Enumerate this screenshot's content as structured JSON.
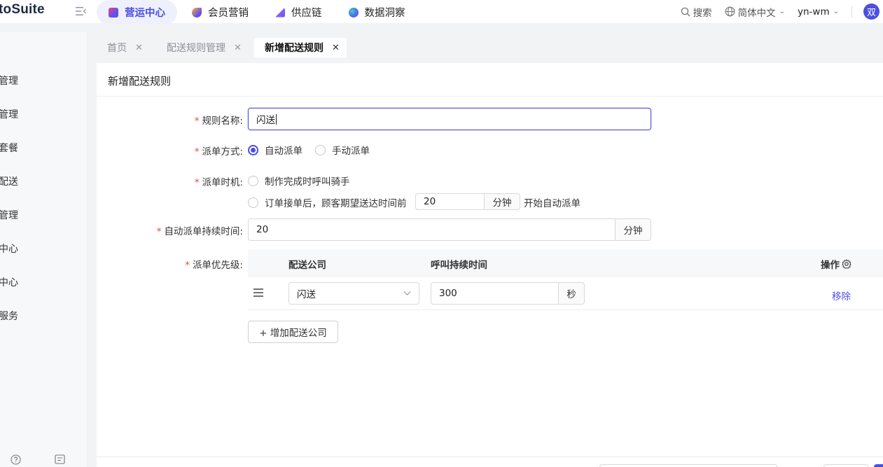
{
  "app": {
    "logo_text": "toSuite"
  },
  "nav": [
    {
      "label": "营运中心",
      "icon": "operations-cube-icon",
      "active": true
    },
    {
      "label": "会员营销",
      "icon": "member-marketing-icon",
      "active": false
    },
    {
      "label": "供应链",
      "icon": "supply-chain-icon",
      "active": false
    },
    {
      "label": "数据洞察",
      "icon": "data-insight-icon",
      "active": false
    }
  ],
  "header_right": {
    "search_label": "搜索",
    "language_label": "简体中文",
    "user_label": "yn-wm",
    "avatar_text": "双"
  },
  "sidebar": {
    "items": [
      "管理",
      "管理",
      "套餐",
      "配送",
      "管理",
      "中心",
      "中心",
      "服务"
    ]
  },
  "tabs": [
    {
      "label": "首页",
      "active": false
    },
    {
      "label": "配送规则管理",
      "active": false
    },
    {
      "label": "新增配送规则",
      "active": true
    }
  ],
  "form": {
    "title": "新增配送规则",
    "rule_name": {
      "label": "规则名称:",
      "value": "闪送"
    },
    "dispatch_mode": {
      "label": "派单方式:",
      "options": [
        "自动派单",
        "手动派单"
      ],
      "selected": "自动派单"
    },
    "dispatch_timing": {
      "label": "派单时机:",
      "option1": "制作完成时呼叫骑手",
      "option2_prefix": "订单接单后，顾客期望送达时间前",
      "option2_value": "20",
      "option2_unit": "分钟",
      "option2_suffix": "开始自动派单"
    },
    "auto_duration": {
      "label": "自动派单持续时间:",
      "value": "20",
      "unit": "分钟"
    },
    "priority": {
      "label": "派单优先级:",
      "columns": [
        "配送公司",
        "呼叫持续时间",
        "操作"
      ],
      "rows": [
        {
          "company": "闪送",
          "duration": "300",
          "unit": "秒",
          "action": "移除"
        }
      ],
      "add_button": "+ 增加配送公司"
    }
  },
  "colors": {
    "accent": "#4b4fe0",
    "required": "#e5484d"
  }
}
